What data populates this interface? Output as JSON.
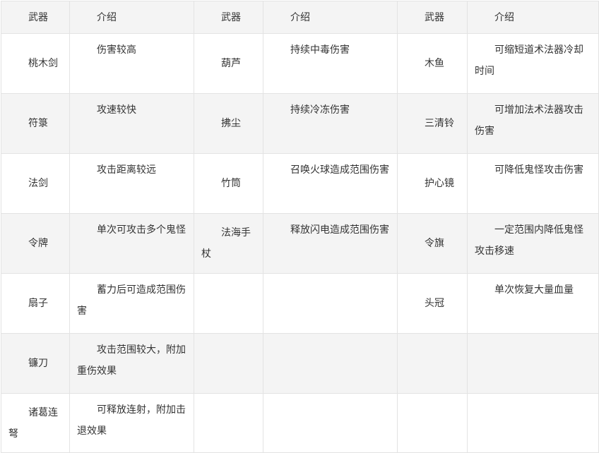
{
  "table": {
    "headers": [
      "武器",
      "介绍",
      "武器",
      "介绍",
      "武器",
      "介绍"
    ],
    "rows": [
      {
        "w1": "桃木剑",
        "d1": "伤害较高",
        "w2": "葫芦",
        "d2": "持续中毒伤害",
        "w3": "木鱼",
        "d3": "可缩短道术法器冷却时间"
      },
      {
        "w1": "符箓",
        "d1": "攻速较快",
        "w2": "拂尘",
        "d2": "持续冷冻伤害",
        "w3": "三清铃",
        "d3": "可增加法术法器攻击伤害"
      },
      {
        "w1": "法剑",
        "d1": "攻击距离较远",
        "w2": "竹筒",
        "d2": "召唤火球造成范围伤害",
        "w3": "护心镜",
        "d3": "可降低鬼怪攻击伤害"
      },
      {
        "w1": "令牌",
        "d1": "单次可攻击多个鬼怪",
        "w2": "法海手杖",
        "d2": "释放闪电造成范围伤害",
        "w3": "令旗",
        "d3": "一定范围内降低鬼怪攻击移速"
      },
      {
        "w1": "扇子",
        "d1": "蓄力后可造成范围伤害",
        "w2": "",
        "d2": "",
        "w3": "头冠",
        "d3": "单次恢复大量血量"
      },
      {
        "w1": "镰刀",
        "d1": "攻击范围较大，附加重伤效果",
        "w2": "",
        "d2": "",
        "w3": "",
        "d3": ""
      },
      {
        "w1": "诸葛连弩",
        "d1": "可释放连射，附加击退效果",
        "w2": "",
        "d2": "",
        "w3": "",
        "d3": ""
      }
    ]
  }
}
